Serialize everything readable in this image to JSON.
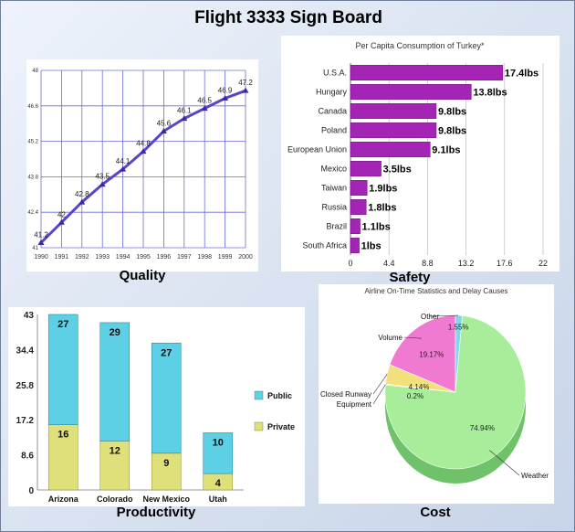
{
  "board": {
    "title": "Flight 3333 Sign Board",
    "captions": {
      "quality": "Quality",
      "safety": "Safety",
      "productivity": "Productivity",
      "cost": "Cost"
    }
  },
  "colors": {
    "line": "#5a44c8",
    "bar_purple": "#a324b5",
    "bar_public": "#5ed0e6",
    "bar_private": "#dfe07a",
    "pie_weather": "#a8ee9a",
    "pie_volume": "#f07ad2",
    "pie_runway": "#f4e07a",
    "pie_equipment": "#f6c070",
    "pie_other": "#7fd6ee"
  },
  "chart_data": [
    {
      "id": "quality",
      "type": "line",
      "x": [
        "1990",
        "1991",
        "1992",
        "1993",
        "1994",
        "1995",
        "1996",
        "1997",
        "1998",
        "1999",
        "2000"
      ],
      "values": [
        41.2,
        42,
        42.8,
        43.5,
        44.1,
        44.8,
        45.6,
        46.1,
        46.5,
        46.9,
        47.2
      ],
      "data_labels": [
        "41.2",
        "42",
        "42.8",
        "43.5",
        "44.1",
        "44.8",
        "45.6",
        "46.1",
        "46.5",
        "46.9",
        "47.2"
      ],
      "yticks": [
        "41",
        "42.4",
        "43.8",
        "45.2",
        "46.6",
        "48"
      ],
      "ylim": [
        41,
        48
      ],
      "grid": true
    },
    {
      "id": "safety",
      "type": "bar",
      "orientation": "horizontal",
      "title": "Per Capita Consumption of Turkey*",
      "categories": [
        "U.S.A.",
        "Hungary",
        "Canada",
        "Poland",
        "European Union",
        "Mexico",
        "Taiwan",
        "Russia",
        "Brazil",
        "South Africa"
      ],
      "values": [
        17.4,
        13.8,
        9.8,
        9.8,
        9.1,
        3.5,
        1.9,
        1.8,
        1.1,
        1
      ],
      "data_labels": [
        "17.4lbs",
        "13.8lbs",
        "9.8lbs",
        "9.8lbs",
        "9.1lbs",
        "3.5lbs",
        "1.9lbs",
        "1.8lbs",
        "1.1lbs",
        "1lbs"
      ],
      "xticks": [
        "0",
        "4.4",
        "8.8",
        "13.2",
        "17.6",
        "22"
      ],
      "xlim": [
        0,
        22
      ],
      "grid": true
    },
    {
      "id": "productivity",
      "type": "bar",
      "stacked": true,
      "categories": [
        "Arizona",
        "Colorado",
        "New Mexico",
        "Utah"
      ],
      "series": [
        {
          "name": "Private",
          "values": [
            16,
            12,
            9,
            4
          ]
        },
        {
          "name": "Public",
          "values": [
            27,
            29,
            27,
            10
          ]
        }
      ],
      "yticks": [
        "0",
        "8.6",
        "17.2",
        "25.8",
        "34.4",
        "43"
      ],
      "ylim": [
        0,
        43
      ],
      "legend": "right"
    },
    {
      "id": "cost",
      "type": "pie",
      "title": "Airline On-Time Statistics and Delay Causes",
      "slices": [
        {
          "label": "Weather",
          "value": 74.94,
          "pct": "74.94%"
        },
        {
          "label": "Equipment",
          "value": 0.2,
          "pct": "0.2%"
        },
        {
          "label": "Closed Runway",
          "value": 4.14,
          "pct": "4.14%"
        },
        {
          "label": "Volume",
          "value": 19.17,
          "pct": "19.17%"
        },
        {
          "label": "Other",
          "value": 1.55,
          "pct": "1.55%"
        }
      ]
    }
  ]
}
